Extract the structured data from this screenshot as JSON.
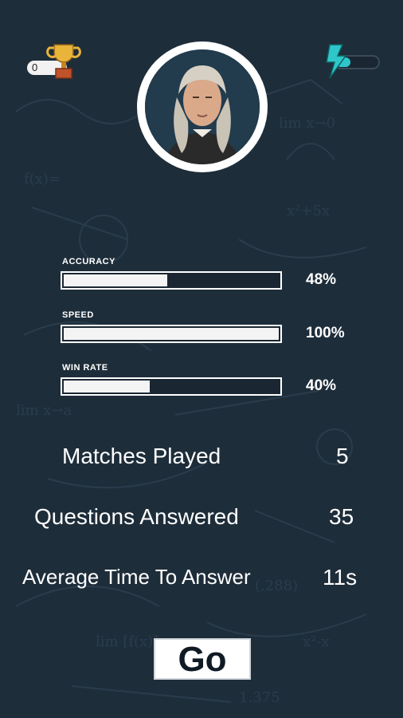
{
  "header": {
    "coins": "0",
    "trophy_icon": "trophy-icon",
    "energy_icon": "lightning-battery-icon",
    "energy_level": 0.35,
    "accent_color": "#2ec7c9"
  },
  "profile": {
    "avatar_icon": "scientist-portrait-icon"
  },
  "stats": [
    {
      "label": "ACCURACY",
      "value": "48%",
      "fraction": 0.48
    },
    {
      "label": "SPEED",
      "value": "100%",
      "fraction": 1.0
    },
    {
      "label": "WIN RATE",
      "value": "40%",
      "fraction": 0.4
    }
  ],
  "summary": [
    {
      "label": "Matches Played",
      "value": "5"
    },
    {
      "label": "Questions Answered",
      "value": "35"
    },
    {
      "label": "Average Time To Answer",
      "value": "11s"
    }
  ],
  "go_button": {
    "label": "Go"
  }
}
